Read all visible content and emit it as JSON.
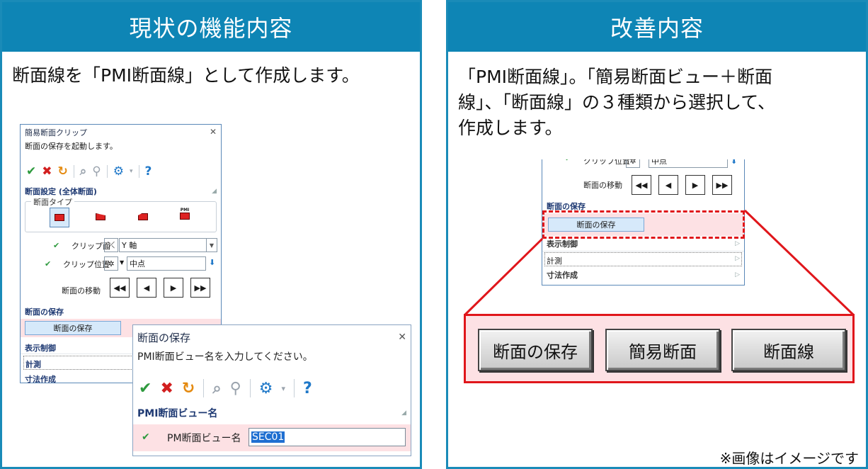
{
  "left": {
    "header": "現状の機能内容",
    "desc": "断面線を「PMI断面線」として作成します。",
    "clip_dialog": {
      "title": "簡易断面クリップ",
      "prompt": "断面の保存を起動します。",
      "section_settings": "断面設定 (全体断面)",
      "section_type_label": "断面タイプ",
      "pmi_icon_text": "PMI",
      "clip_plane_label": "クリップ面",
      "clip_plane_value": "Y 軸",
      "clip_pos_label": "クリップ位置",
      "clip_pos_value": "中点",
      "move_label": "断面の移動",
      "save_section": "断面の保存",
      "save_button": "断面の保存",
      "display_control": "表示制御",
      "measure": "計測",
      "dimension": "寸法作成"
    },
    "save_dialog": {
      "title": "断面の保存",
      "prompt": "PMI断面ビュー名を入力してください。",
      "section": "PMI断面ビュー名",
      "field_label": "PM断面ビュー名",
      "field_value": "SEC01"
    }
  },
  "right": {
    "header": "改善内容",
    "desc_lines": [
      "「PMI断面線」。「簡易断面ビュー＋断面",
      "線」、「断面線」の３種類から選択して、",
      "作成します。"
    ],
    "mini_dialog": {
      "clip_pos_label": "クリップ位置",
      "clip_pos_value": "中点",
      "move_label": "断面の移動",
      "save_section": "断面の保存",
      "save_button": "断面の保存",
      "display_control": "表示制御",
      "measure": "計測",
      "dimension": "寸法作成"
    },
    "options": [
      "断面の保存",
      "簡易断面",
      "断面線"
    ],
    "note": "※画像はイメージです"
  },
  "colors": {
    "header_bg": "#0e85b5",
    "highlight_red": "#e0161b",
    "highlight_pink": "#fde1e4"
  }
}
